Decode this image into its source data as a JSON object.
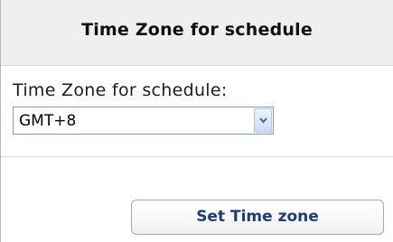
{
  "header": {
    "title": "Time Zone for schedule"
  },
  "form": {
    "label": "Time Zone for schedule:",
    "timezone_select": {
      "selected": "GMT+8",
      "icon": "chevron-down-icon"
    }
  },
  "actions": {
    "set_label": "Set Time zone"
  },
  "colors": {
    "header_bg": "#efefef",
    "button_text": "#1f3c7a",
    "select_border": "#7f9db9"
  }
}
